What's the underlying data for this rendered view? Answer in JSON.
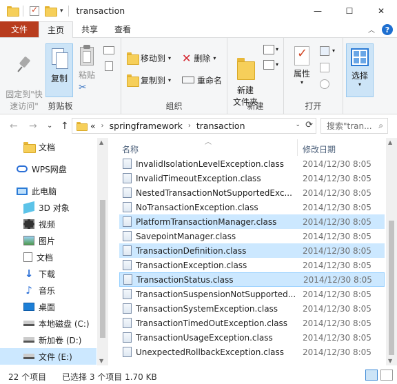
{
  "window": {
    "title": "transaction",
    "minimize_glyph": "—",
    "maximize_glyph": "☐",
    "close_glyph": "✕"
  },
  "tabs": [
    {
      "label": "文件"
    },
    {
      "label": "主页"
    },
    {
      "label": "共享"
    },
    {
      "label": "查看"
    }
  ],
  "ribbon": {
    "clipboard": {
      "pin_label": "固定到\"快速访问\"",
      "copy_label": "复制",
      "paste_label": "粘贴",
      "group_label": "剪贴板"
    },
    "organize": {
      "move_label": "移动到",
      "copy_to_label": "复制到",
      "delete_label": "删除",
      "rename_label": "重命名",
      "group_label": "组织"
    },
    "new": {
      "new_folder_label": "新建\n文件夹",
      "group_label": "新建"
    },
    "open": {
      "properties_label": "属性",
      "group_label": "打开"
    },
    "select": {
      "select_label": "选择"
    }
  },
  "address": {
    "overflow": "«",
    "crumbs": [
      "springframework",
      "transaction"
    ],
    "search_placeholder": "搜索\"tran...",
    "back_glyph": "←",
    "forward_glyph": "→",
    "recent_glyph": "⌄",
    "up_glyph": "↑",
    "refresh_glyph": "⟳"
  },
  "nav": {
    "items": [
      {
        "label": "文档",
        "icon": "folder-icon"
      },
      {
        "label": "WPS网盘",
        "icon": "cloud-icon"
      },
      {
        "label": "此电脑",
        "icon": "computer-icon"
      },
      {
        "label": "3D 对象",
        "icon": "3d-objects-icon"
      },
      {
        "label": "视频",
        "icon": "video-icon"
      },
      {
        "label": "图片",
        "icon": "pictures-icon"
      },
      {
        "label": "文档",
        "icon": "documents-icon"
      },
      {
        "label": "下载",
        "icon": "download-icon"
      },
      {
        "label": "音乐",
        "icon": "music-icon"
      },
      {
        "label": "桌面",
        "icon": "desktop-icon"
      },
      {
        "label": "本地磁盘 (C:)",
        "icon": "drive-icon"
      },
      {
        "label": "新加卷 (D:)",
        "icon": "drive-icon"
      },
      {
        "label": "文件 (E:)",
        "icon": "drive-icon"
      }
    ]
  },
  "columns": {
    "name": "名称",
    "date": "修改日期"
  },
  "files": [
    {
      "name": "InvalidIsolationLevelException.class",
      "date": "2014/12/30 8:05",
      "selected": false
    },
    {
      "name": "InvalidTimeoutException.class",
      "date": "2014/12/30 8:05",
      "selected": false
    },
    {
      "name": "NestedTransactionNotSupportedExc...",
      "date": "2014/12/30 8:05",
      "selected": false
    },
    {
      "name": "NoTransactionException.class",
      "date": "2014/12/30 8:05",
      "selected": false
    },
    {
      "name": "PlatformTransactionManager.class",
      "date": "2014/12/30 8:05",
      "selected": true
    },
    {
      "name": "SavepointManager.class",
      "date": "2014/12/30 8:05",
      "selected": false
    },
    {
      "name": "TransactionDefinition.class",
      "date": "2014/12/30 8:05",
      "selected": true
    },
    {
      "name": "TransactionException.class",
      "date": "2014/12/30 8:05",
      "selected": false
    },
    {
      "name": "TransactionStatus.class",
      "date": "2014/12/30 8:05",
      "selected": true
    },
    {
      "name": "TransactionSuspensionNotSupported...",
      "date": "2014/12/30 8:05",
      "selected": false
    },
    {
      "name": "TransactionSystemException.class",
      "date": "2014/12/30 8:05",
      "selected": false
    },
    {
      "name": "TransactionTimedOutException.class",
      "date": "2014/12/30 8:05",
      "selected": false
    },
    {
      "name": "TransactionUsageException.class",
      "date": "2014/12/30 8:05",
      "selected": false
    },
    {
      "name": "UnexpectedRollbackException.class",
      "date": "2014/12/30 8:05",
      "selected": false
    }
  ],
  "status": {
    "count": "22 个项目",
    "selection": "已选择 3 个项目  1.70 KB"
  }
}
